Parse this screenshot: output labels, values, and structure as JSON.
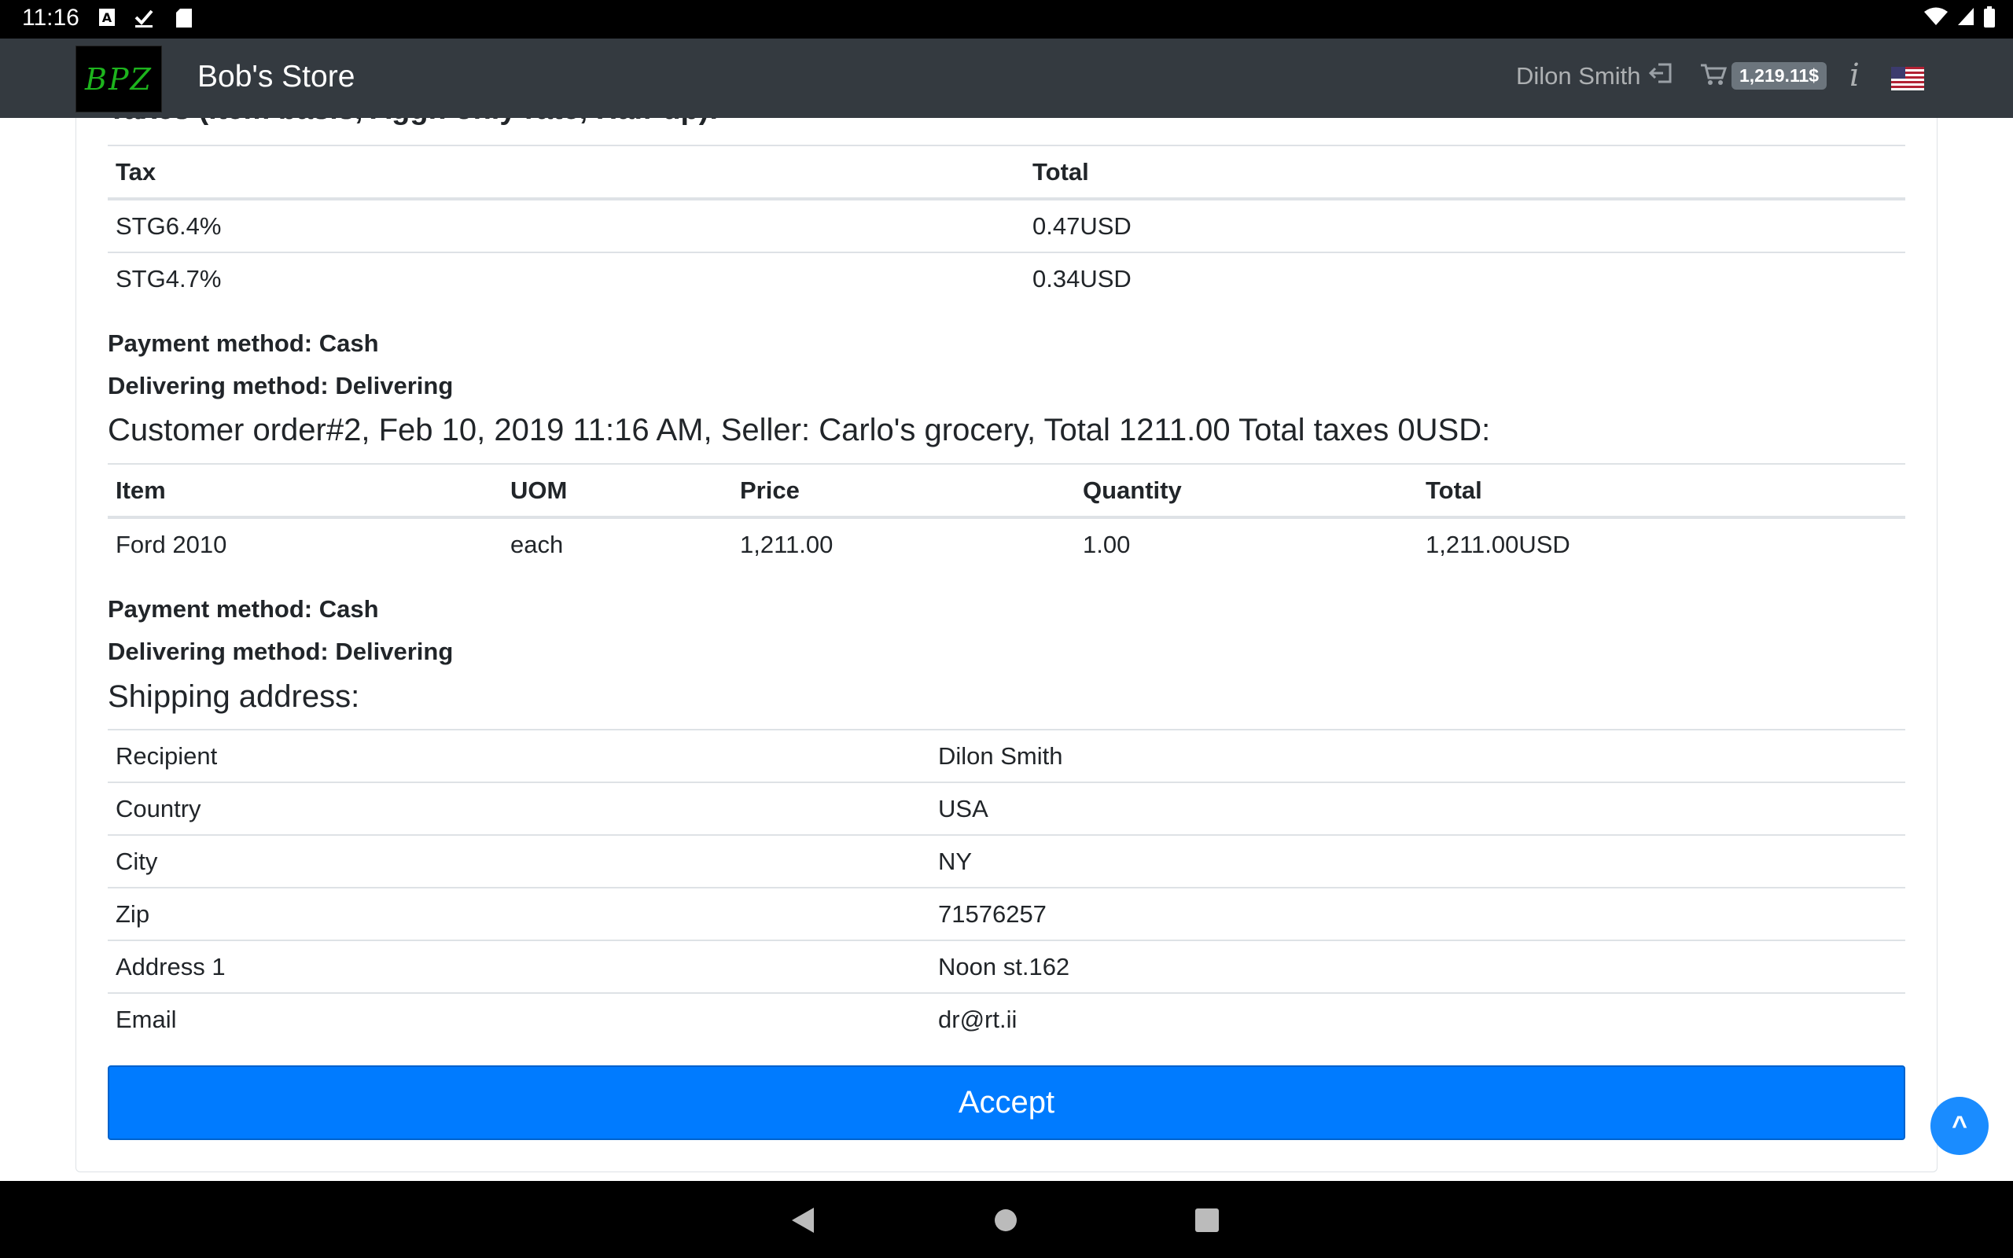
{
  "status_bar": {
    "time": "11:16"
  },
  "header": {
    "logo_text": "BPZ",
    "brand": "Bob's Store",
    "user_name": "Dilon Smith",
    "cart_total": "1,219.11$"
  },
  "taxes_section": {
    "title": "Taxes (item basis, Aggr. only rate, Half-up):",
    "columns": [
      "Tax",
      "Total"
    ],
    "rows": [
      [
        "STG6.4%",
        "0.47USD"
      ],
      [
        "STG4.7%",
        "0.34USD"
      ]
    ],
    "payment_method": "Payment method: Cash",
    "delivering_method": "Delivering method: Delivering"
  },
  "order2": {
    "title": "Customer order#2, Feb 10, 2019 11:16 AM, Seller: Carlo's grocery, Total 1211.00 Total taxes 0USD:",
    "columns": [
      "Item",
      "UOM",
      "Price",
      "Quantity",
      "Total"
    ],
    "rows": [
      [
        "Ford 2010",
        "each",
        "1,211.00",
        "1.00",
        "1,211.00USD"
      ]
    ],
    "payment_method": "Payment method: Cash",
    "delivering_method": "Delivering method: Delivering"
  },
  "shipping": {
    "title": "Shipping address:",
    "rows": [
      [
        "Recipient",
        "Dilon Smith"
      ],
      [
        "Country",
        "USA"
      ],
      [
        "City",
        "NY"
      ],
      [
        "Zip",
        "71576257"
      ],
      [
        "Address 1",
        "Noon st.162"
      ],
      [
        "Email",
        "dr@rt.ii"
      ]
    ]
  },
  "actions": {
    "accept_label": "Accept",
    "to_top_label": "^"
  }
}
